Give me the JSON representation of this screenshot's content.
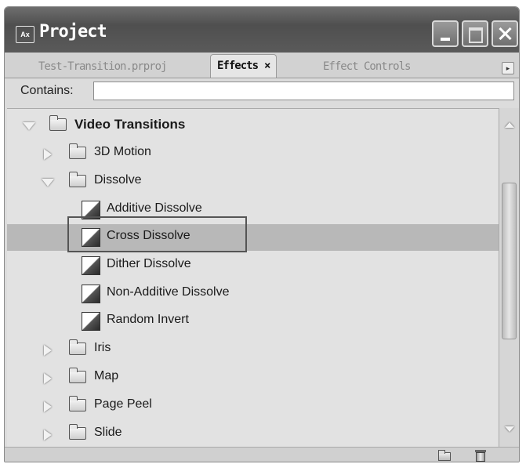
{
  "window": {
    "title": "Project",
    "app_icon_text": "Ax"
  },
  "tabs": [
    {
      "label": "Test-Transition.prproj",
      "active": false
    },
    {
      "label": "Effects",
      "active": true,
      "close": "×"
    },
    {
      "label": "Effect Controls",
      "active": false
    }
  ],
  "search": {
    "label": "Contains:",
    "value": "",
    "placeholder": ""
  },
  "tree": {
    "root": "Video Transitions",
    "folder_3d": "3D Motion",
    "folder_dissolve": "Dissolve",
    "items": {
      "additive": "Additive Dissolve",
      "cross": "Cross Dissolve",
      "dither": "Dither Dissolve",
      "non_additive": "Non-Additive Dissolve",
      "random_invert": "Random Invert"
    },
    "folder_iris": "Iris",
    "folder_map": "Map",
    "folder_page_peel": "Page Peel",
    "folder_slide": "Slide",
    "selected": "Cross Dissolve"
  },
  "icons": {
    "folder": "folder-icon",
    "transition": "transition-effect-icon",
    "new_bin": "new-bin-icon",
    "delete": "trash-icon"
  },
  "colors": {
    "titlebar": "#5a5a5a",
    "selection": "#b8b8b8"
  }
}
